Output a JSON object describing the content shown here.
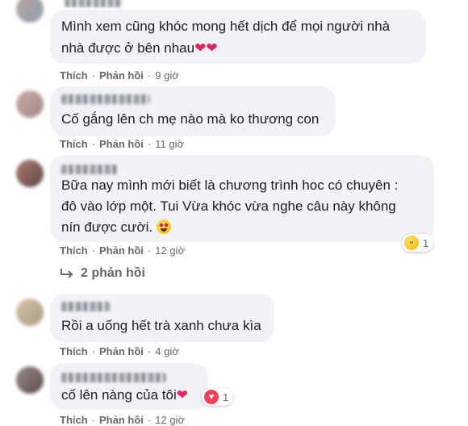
{
  "comments": [
    {
      "lines": [
        "Mình xem cũng khóc mong hết dịch để mọi người nhà",
        "nhà được ở bên nhau"
      ],
      "like": "Thích",
      "reply": "Phản hồi",
      "time": "9 giờ"
    },
    {
      "lines": [
        "Cố gắng lên ch mẹ nào mà ko thương con"
      ],
      "like": "Thích",
      "reply": "Phản hồi",
      "time": "11 giờ"
    },
    {
      "lines": [
        "Bữa nay mình mới biết là chương trình hoc có chuyên :",
        "đô vào lớp một. Tui Vừa khóc vừa nghe câu này không",
        "nín được cười."
      ],
      "like": "Thích",
      "reply": "Phản hồi",
      "time": "12 giờ",
      "reaction_count": "1"
    },
    {
      "lines": [
        "Rồi a uống hết trà xanh chưa kìa"
      ],
      "like": "Thích",
      "reply": "Phản hồi",
      "time": "4 giờ"
    },
    {
      "lines": [
        "cố lên nàng của tôi"
      ],
      "like": "Thích",
      "reply": "Phản hồi",
      "time": "12 giờ",
      "reaction_count": "1"
    }
  ],
  "replies_link": "2 phản hồi",
  "colors": {
    "bubble": "#f0f2f5",
    "meta_text": "#65676b",
    "heart": "#e0245e"
  },
  "icons": {
    "heart": "heart-icon",
    "grin_heart_eyes": "heart-eyes-emoji-icon",
    "haha": "haha-reaction-icon",
    "love": "love-reaction-icon",
    "reply_arrow": "reply-arrow-icon"
  }
}
